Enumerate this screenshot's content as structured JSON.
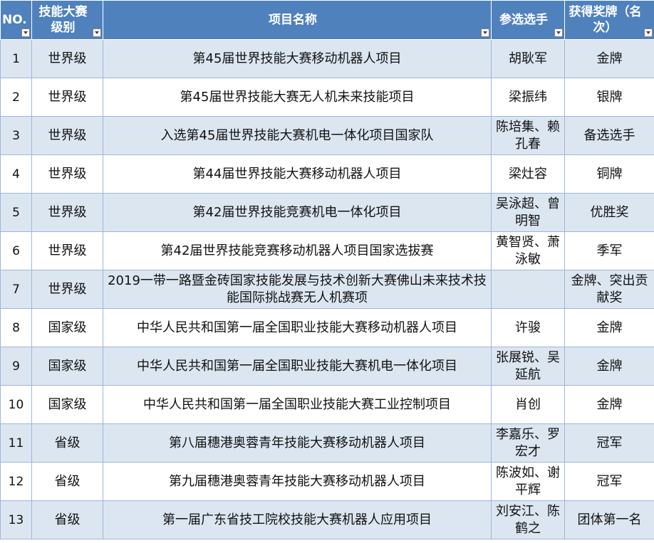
{
  "columns": [
    {
      "label": "NO."
    },
    {
      "label": "技能大赛级别"
    },
    {
      "label": "项目名称"
    },
    {
      "label": "参选选手"
    },
    {
      "label": "获得奖牌（名次）"
    }
  ],
  "rows": [
    {
      "no": "1",
      "level": "世界级",
      "project": "第45届世界技能大赛移动机器人项目",
      "players": "胡耿军",
      "award": "金牌"
    },
    {
      "no": "2",
      "level": "世界级",
      "project": "第45届世界技能大赛无人机未来技能项目",
      "players": "梁振纬",
      "award": "银牌"
    },
    {
      "no": "3",
      "level": "世界级",
      "project": "入选第45届世界技能大赛机电一体化项目国家队",
      "players": "陈培集、赖孔春",
      "award": "备选选手"
    },
    {
      "no": "4",
      "level": "世界级",
      "project": "第44届世界技能大赛移动机器人项目",
      "players": "梁灶容",
      "award": "铜牌"
    },
    {
      "no": "5",
      "level": "世界级",
      "project": "第42届世界技能竞赛机电一体化项目",
      "players": "吴泳超、曾明智",
      "award": "优胜奖"
    },
    {
      "no": "6",
      "level": "世界级",
      "project": "第42届世界技能竞赛移动机器人项目国家选拔赛",
      "players": "黄智贤、萧泳敏",
      "award": "季军"
    },
    {
      "no": "7",
      "level": "世界级",
      "project": "2019一带一路暨金砖国家技能发展与技术创新大赛佛山未来技术技能国际挑战赛无人机赛项",
      "players": "",
      "award": "金牌、突出贡献奖"
    },
    {
      "no": "8",
      "level": "国家级",
      "project": "中华人民共和国第一届全国职业技能大赛移动机器人项目",
      "players": "许骏",
      "award": "金牌"
    },
    {
      "no": "9",
      "level": "国家级",
      "project": "中华人民共和国第一届全国职业技能大赛机电一体化项目",
      "players": "张展锐、吴延航",
      "award": "金牌"
    },
    {
      "no": "10",
      "level": "国家级",
      "project": "中华人民共和国第一届全国职业技能大赛工业控制项目",
      "players": "肖创",
      "award": "金牌"
    },
    {
      "no": "11",
      "level": "省级",
      "project": "第八届穗港奥蓉青年技能大赛移动机器人项目",
      "players": "李嘉乐、罗宏才",
      "award": "冠军"
    },
    {
      "no": "12",
      "level": "省级",
      "project": "第九届穗港奥蓉青年技能大赛移动机器人项目",
      "players": "陈波如、谢平辉",
      "award": "冠军"
    },
    {
      "no": "13",
      "level": "省级",
      "project": "第一届广东省技工院校技能大赛机器人应用项目",
      "players": "刘安江、陈鹤之",
      "award": "团体第一名"
    }
  ]
}
